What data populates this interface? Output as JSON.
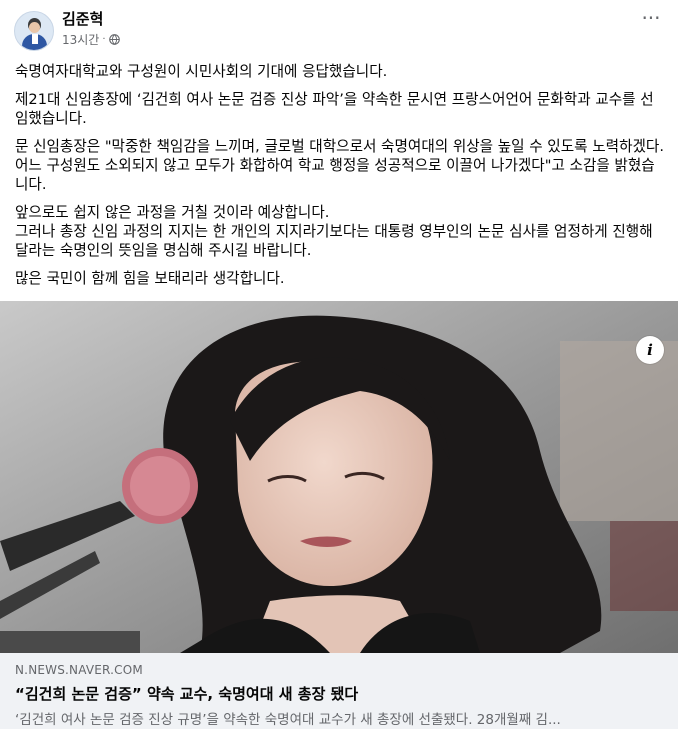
{
  "post": {
    "author": "김준혁",
    "time": "13시간",
    "separator": "·",
    "paragraphs": [
      "숙명여자대학교와 구성원이 시민사회의 기대에 응답했습니다.",
      "제21대 신임총장에 ‘김건희 여사 논문 검증 진상 파악’을 약속한 문시연 프랑스어언어 문화학과 교수를 선임했습니다.",
      "문 신임총장은 \"막중한 책임감을 느끼며, 글로벌 대학으로서 숙명여대의 위상을 높일 수 있도록 노력하겠다. 어느 구성원도 소외되지 않고 모두가 화합하여 학교 행정을 성공적으로 이끌어 나가겠다\"고 소감을 밝혔습니다.",
      "앞으로도 쉽지 않은 과정을 거칠 것이라 예상합니다.\n그러나 총장 신임 과정의 지지는 한 개인의 지지라기보다는 대통령 영부인의 논문 심사를 엄정하게 진행해 달라는 숙명인의 뜻임을 명심해 주시길 바랍니다.",
      "많은 국민이 함께 힘을 보태리라 생각합니다."
    ]
  },
  "link_preview": {
    "domain": "N.NEWS.NAVER.COM",
    "title": "“김건희 논문 검증” 약속 교수, 숙명여대 새 총장 됐다",
    "description": "‘김건희 여사 논문 검증 진상 규명’을 약속한 숙명여대 교수가 새 총장에 선출됐다. 28개월째 김..."
  },
  "icons": {
    "more": "more-options-icon",
    "privacy": "globe-icon",
    "info": "info-icon"
  },
  "colors": {
    "text": "#050505",
    "secondary": "#65676b",
    "link_bg": "#f0f2f5"
  }
}
